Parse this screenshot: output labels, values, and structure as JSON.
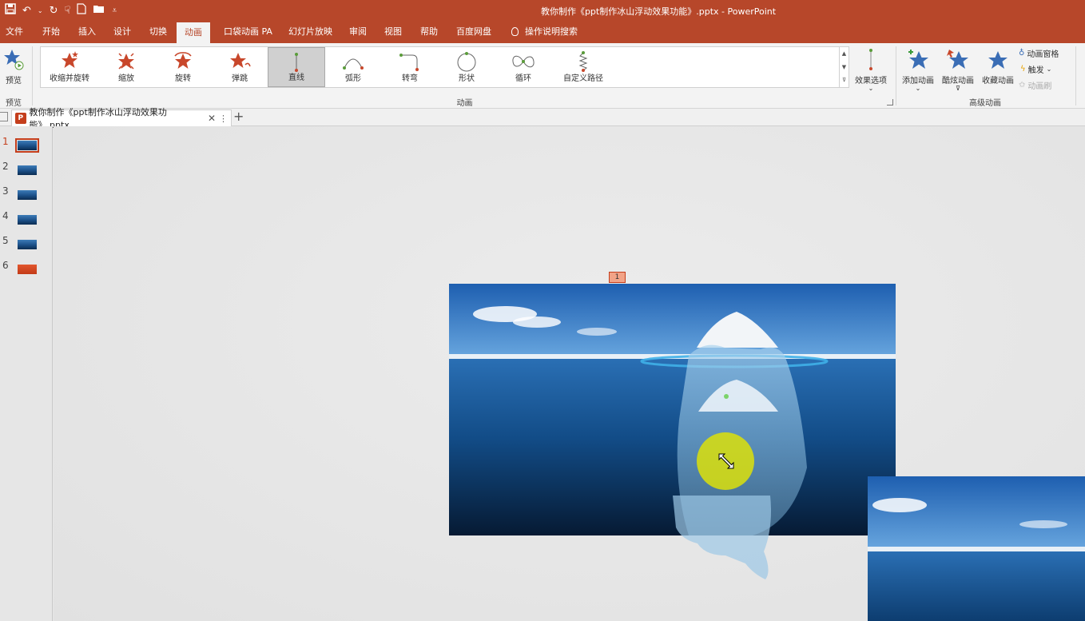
{
  "window": {
    "title": "教你制作《ppt制作冰山浮动效果功能》.pptx  -  PowerPoint",
    "qat_icons": [
      "save-icon",
      "undo-icon",
      "redo-icon",
      "touch-mode-icon",
      "new-file-icon",
      "open-folder-icon",
      "customize-qat-icon"
    ]
  },
  "tabs": [
    {
      "label": "文件"
    },
    {
      "label": "开始"
    },
    {
      "label": "插入"
    },
    {
      "label": "设计"
    },
    {
      "label": "切换"
    },
    {
      "label": "动画",
      "active": true
    },
    {
      "label": "口袋动画 PA"
    },
    {
      "label": "幻灯片放映"
    },
    {
      "label": "审阅"
    },
    {
      "label": "视图"
    },
    {
      "label": "帮助"
    },
    {
      "label": "百度网盘"
    },
    {
      "label": "操作说明搜索"
    }
  ],
  "ribbon": {
    "preview": {
      "button_label": "预览",
      "group_label": "预览"
    },
    "animation_group_label": "动画",
    "gallery": [
      {
        "label": "收缩并旋转",
        "icon": "shrink-turn-star-icon"
      },
      {
        "label": "缩放",
        "icon": "zoom-star-icon"
      },
      {
        "label": "旋转",
        "icon": "spin-star-icon"
      },
      {
        "label": "弹跳",
        "icon": "bounce-star-icon"
      },
      {
        "label": "直线",
        "icon": "line-path-icon",
        "selected": true
      },
      {
        "label": "弧形",
        "icon": "arc-path-icon"
      },
      {
        "label": "转弯",
        "icon": "turn-path-icon"
      },
      {
        "label": "形状",
        "icon": "shape-path-icon"
      },
      {
        "label": "循环",
        "icon": "loop-path-icon"
      },
      {
        "label": "自定义路径",
        "icon": "custom-path-icon"
      }
    ],
    "effect_options": "效果选项",
    "advanced": {
      "group_label": "高级动画",
      "add_animation": "添加动画",
      "cool_animation": "酷炫动画",
      "favorite_animation": "收藏动画",
      "animation_pane": "动画窗格",
      "trigger": "触发",
      "animation_painter": "动画刷"
    }
  },
  "document_tab": {
    "label": "教你制作《ppt制作冰山浮动效果功能》.pptx"
  },
  "slides": [
    {
      "number": "1",
      "active": true
    },
    {
      "number": "2"
    },
    {
      "number": "3"
    },
    {
      "number": "4"
    },
    {
      "number": "5"
    },
    {
      "number": "6",
      "style": "red"
    }
  ],
  "canvas": {
    "animation_tag": "1"
  },
  "colors": {
    "accent": "#b7472a",
    "ribbon_bg": "#f3f3f3",
    "selection": "#c43e1c"
  }
}
